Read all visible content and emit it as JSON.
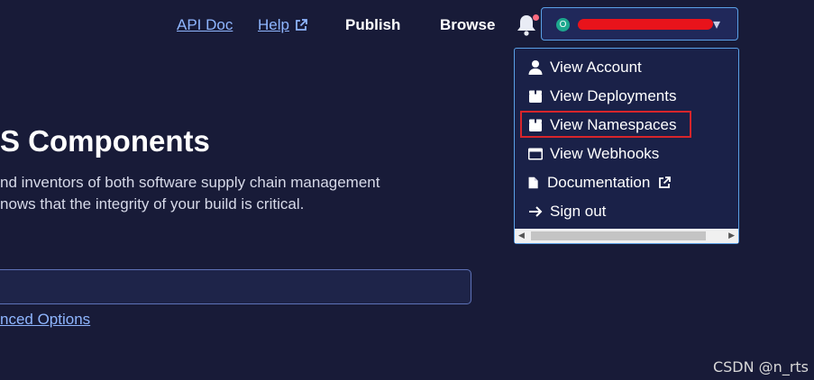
{
  "header": {
    "api_doc": "API Doc",
    "help": "Help",
    "publish": "Publish",
    "browse": "Browse",
    "notification_icon": "bell-icon",
    "user_avatar_initial": "O"
  },
  "user_menu": {
    "items": [
      {
        "label": "View Account",
        "icon": "person-icon"
      },
      {
        "label": "View Deployments",
        "icon": "package-icon"
      },
      {
        "label": "View Namespaces",
        "icon": "package-icon"
      },
      {
        "label": "View Webhooks",
        "icon": "window-icon"
      },
      {
        "label": "Documentation",
        "icon": "document-icon"
      },
      {
        "label": "Sign out",
        "icon": "arrow-right-icon"
      }
    ],
    "highlighted_item": "View Namespaces",
    "highlight_color": "#d8252b"
  },
  "main": {
    "heading": "S Components",
    "description_line1": "nd inventors of both software supply chain management",
    "description_line2": "nows that the integrity of your build is critical.",
    "advanced_options": "nced Options"
  },
  "watermark": "CSDN @n_rts",
  "colors": {
    "background": "#181b38",
    "accent_link": "#8fb6ff",
    "border_accent": "#5aa0e6"
  }
}
